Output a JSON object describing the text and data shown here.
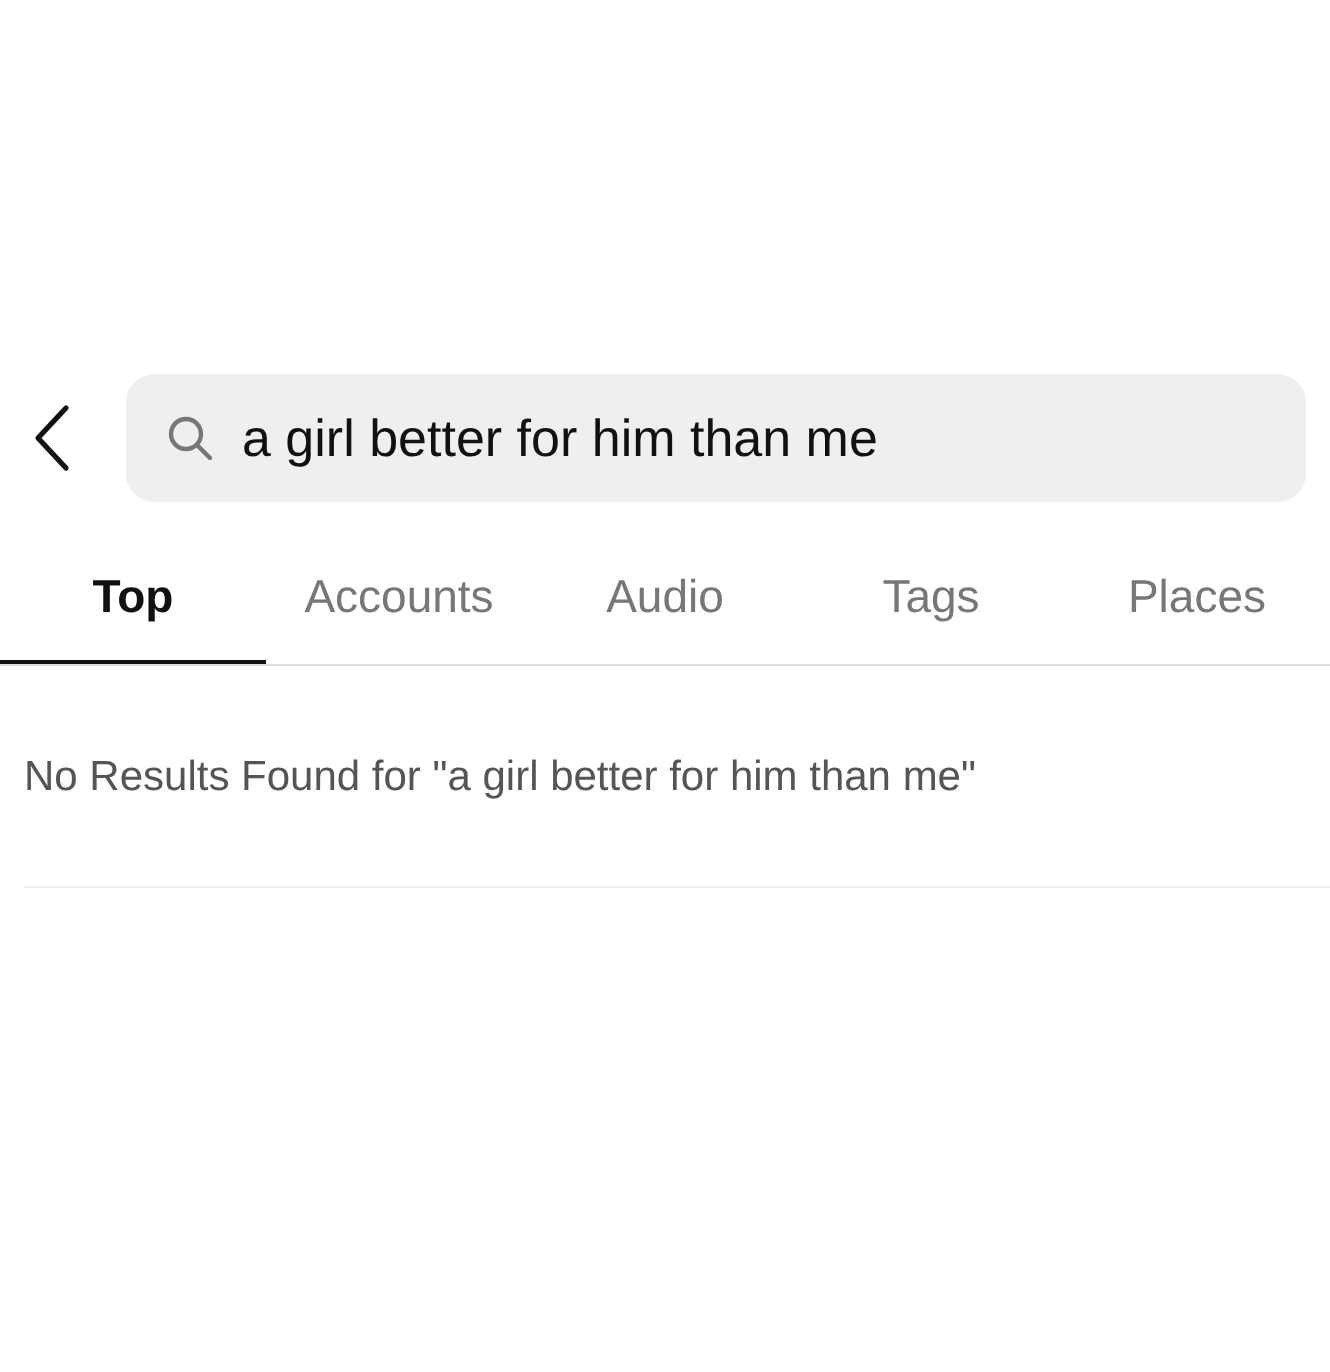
{
  "search": {
    "value": "a girl better for him than me"
  },
  "tabs": [
    {
      "label": "Top",
      "selected": true
    },
    {
      "label": "Accounts",
      "selected": false
    },
    {
      "label": "Audio",
      "selected": false
    },
    {
      "label": "Tags",
      "selected": false
    },
    {
      "label": "Places",
      "selected": false
    }
  ],
  "message": "No Results Found for \"a girl better for him than me\""
}
